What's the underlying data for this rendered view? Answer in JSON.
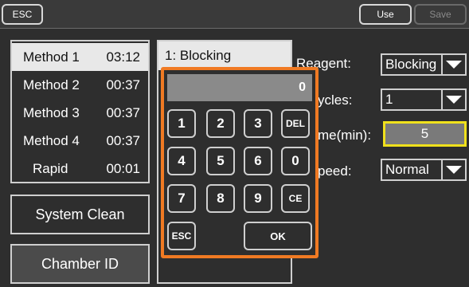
{
  "toolbar": {
    "esc_label": "ESC",
    "use_label": "Use",
    "save_label": "Save"
  },
  "methods": [
    {
      "name": "Method 1",
      "time": "03:12",
      "selected": true
    },
    {
      "name": "Method 2",
      "time": "00:37",
      "selected": false
    },
    {
      "name": "Method 3",
      "time": "00:37",
      "selected": false
    },
    {
      "name": "Method 4",
      "time": "00:37",
      "selected": false
    },
    {
      "name": "Rapid",
      "time": "00:01",
      "selected": false
    }
  ],
  "buttons": {
    "system_clean": "System Clean",
    "chamber_id": "Chamber ID"
  },
  "steps": [
    {
      "label": "1: Blocking",
      "selected": true
    }
  ],
  "settings": {
    "reagent_label": "Reagent:",
    "reagent_value": "Blocking",
    "cycles_label": "ycles:",
    "cycles_value": "1",
    "time_label": "me(min):",
    "time_value": "5",
    "speed_label": "peed:",
    "speed_value": "Normal"
  },
  "keypad": {
    "display_value": "0",
    "keys": {
      "k1": "1",
      "k2": "2",
      "k3": "3",
      "del": "DEL",
      "k4": "4",
      "k5": "5",
      "k6": "6",
      "k0": "0",
      "k7": "7",
      "k8": "8",
      "k9": "9",
      "ce": "CE",
      "esc": "ESC",
      "ok": "OK"
    }
  },
  "colors": {
    "keypad_border": "#f07a23",
    "time_field_border": "#f0e11c"
  }
}
